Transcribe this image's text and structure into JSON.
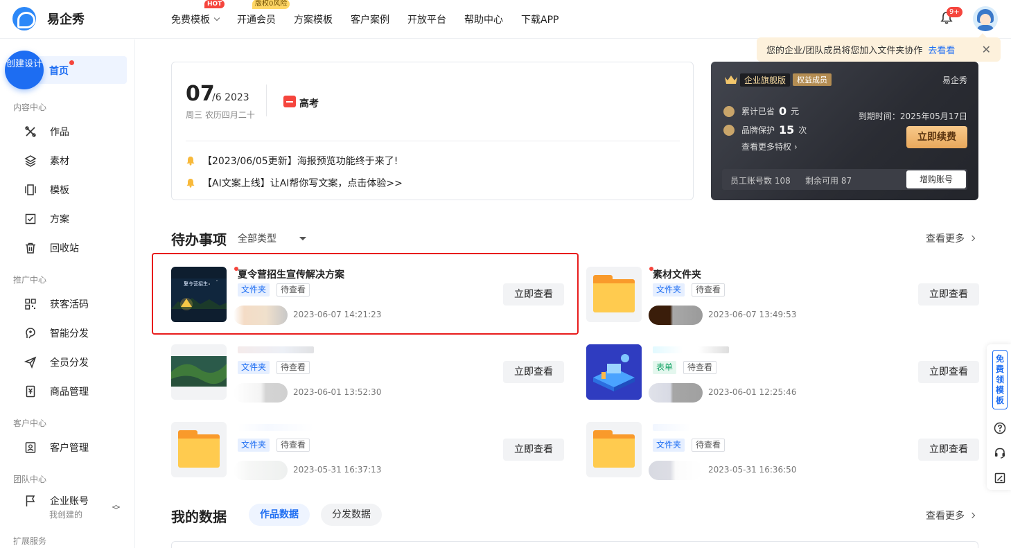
{
  "brand": {
    "name": "易企秀"
  },
  "nav": {
    "items": [
      {
        "label": "免费模板",
        "badge": "HOT",
        "has_dropdown": true
      },
      {
        "label": "开通会员",
        "badge": "版权0风险"
      },
      {
        "label": "方案模板"
      },
      {
        "label": "客户案例"
      },
      {
        "label": "开放平台"
      },
      {
        "label": "帮助中心"
      },
      {
        "label": "下载APP"
      }
    ],
    "bell_badge": "9+"
  },
  "notice": {
    "text": "您的企业/团队成员将您加入文件夹协作",
    "link": "去看看"
  },
  "sidebar": {
    "create_label": "创建设计",
    "home": "首页",
    "sections": {
      "content": "内容中心",
      "promo": "推广中心",
      "customer": "客户中心",
      "team": "团队中心",
      "extend": "扩展服务"
    },
    "items": {
      "works": "作品",
      "materials": "素材",
      "templates": "模板",
      "plans": "方案",
      "recycle": "回收站",
      "lead_code": "获客活码",
      "smart_dist": "智能分发",
      "all_dist": "全员分发",
      "goods": "商品管理",
      "crm": "客户管理",
      "enterprise": "企业账号",
      "enterprise_sub": "我创建的"
    }
  },
  "date_card": {
    "day": "07",
    "rest": "/6  2023",
    "lunar": "周三 农历四月二十",
    "holiday": "高考",
    "news": [
      "【2023/06/05更新】海报预览功能终于来了!",
      "【AI文案上线】让AI帮你写文案，点击体验>>"
    ]
  },
  "vip": {
    "level": "企业旗舰版",
    "member_tag": "权益成员",
    "brand": "易企秀",
    "saved_label": "累计已省",
    "saved_value": "0",
    "saved_unit": "元",
    "protect_label": "品牌保护",
    "protect_value": "15",
    "protect_unit": "次",
    "more_rights": "查看更多特权",
    "expire_label": "到期时间：",
    "expire_date": "2025年05月17日",
    "renew": "立即续费",
    "staff_count": "员工账号数 108",
    "remaining": "剩余可用 87",
    "buy_accounts": "增购账号"
  },
  "todo": {
    "title": "待办事项",
    "filter": "全部类型",
    "more": "查看更多",
    "view_label": "立即查看",
    "items": [
      {
        "title": "夏令营招生宣传解决方案",
        "tag": "文件夹",
        "status": "待查看",
        "time": "2023-06-07 14:21:23",
        "thumb": "photo",
        "thumb_text": "夏令营招生"
      },
      {
        "title": "素材文件夹",
        "tag": "文件夹",
        "status": "待查看",
        "time": "2023-06-07 13:49:53",
        "thumb": "folder"
      },
      {
        "title": "",
        "tag": "文件夹",
        "status": "待查看",
        "time": "2023-06-01 13:52:30",
        "thumb": "photo2"
      },
      {
        "title": "",
        "tag": "表单",
        "status": "待查看",
        "time": "2023-06-01 12:25:46",
        "thumb": "iso"
      },
      {
        "title": "",
        "tag": "文件夹",
        "status": "待查看",
        "time": "2023-05-31 16:37:13",
        "thumb": "folder"
      },
      {
        "title": "",
        "tag": "文件夹",
        "status": "待查看",
        "time": "2023-05-31 16:36:50",
        "thumb": "folder"
      }
    ]
  },
  "my_data": {
    "title": "我的数据",
    "tabs": [
      "作品数据",
      "分发数据"
    ],
    "more": "查看更多"
  },
  "float": {
    "free_templates": "免费领模板"
  },
  "colors": {
    "primary": "#1d6df2",
    "alert": "#f5453d",
    "highlight_border": "#e81c1c"
  }
}
